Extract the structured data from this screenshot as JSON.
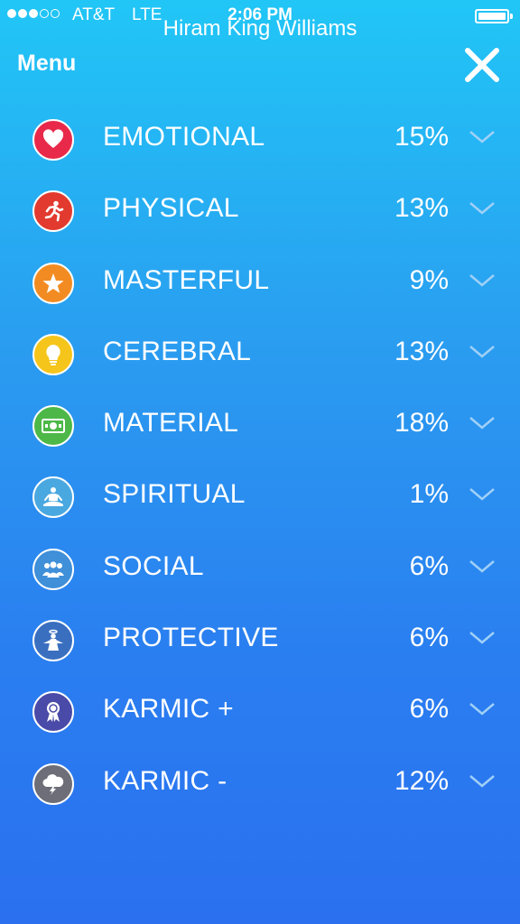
{
  "status_bar": {
    "carrier": "AT&T",
    "network": "LTE",
    "time": "2:06 PM"
  },
  "header": {
    "user_name": "Hiram King Williams",
    "menu_label": "Menu"
  },
  "categories": [
    {
      "label": "EMOTIONAL",
      "percent": "15%",
      "icon": "heart-icon",
      "color": "#e8294a"
    },
    {
      "label": "PHYSICAL",
      "percent": "13%",
      "icon": "runner-icon",
      "color": "#e23a2e"
    },
    {
      "label": "MASTERFUL",
      "percent": "9%",
      "icon": "star-icon",
      "color": "#f28c22"
    },
    {
      "label": "CEREBRAL",
      "percent": "13%",
      "icon": "lightbulb-icon",
      "color": "#f6c51b"
    },
    {
      "label": "MATERIAL",
      "percent": "18%",
      "icon": "money-icon",
      "color": "#4db848"
    },
    {
      "label": "SPIRITUAL",
      "percent": "1%",
      "icon": "meditation-icon",
      "color": "#4aa8e0"
    },
    {
      "label": "SOCIAL",
      "percent": "6%",
      "icon": "group-icon",
      "color": "#3f8fd9"
    },
    {
      "label": "PROTECTIVE",
      "percent": "6%",
      "icon": "angel-icon",
      "color": "#3a6fc0"
    },
    {
      "label": "KARMIC +",
      "percent": "6%",
      "icon": "ribbon-icon",
      "color": "#4a4aa8"
    },
    {
      "label": "KARMIC -",
      "percent": "12%",
      "icon": "storm-cloud-icon",
      "color": "#6e6e78"
    }
  ]
}
